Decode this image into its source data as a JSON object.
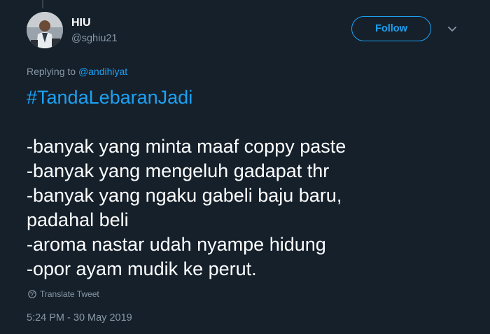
{
  "author": {
    "display_name": "HIU",
    "handle": "@sghiu21"
  },
  "follow_label": "Follow",
  "reply_context": {
    "prefix": "Replying to ",
    "mention": "@andihiyat"
  },
  "tweet": {
    "hashtag": "#TandaLebaranJadi",
    "lines": [
      "-banyak yang minta maaf coppy paste",
      "-banyak yang mengeluh gadapat thr",
      "-banyak yang ngaku gabeli baju baru,",
      "padahal beli",
      "-aroma nastar udah nyampe hidung",
      "-opor ayam mudik ke perut."
    ]
  },
  "translate_label": "Translate Tweet",
  "timestamp": "5:24 PM - 30 May 2019",
  "icons": {
    "avatar": "avatar-photo",
    "more": "chevron-down-icon",
    "translate": "globe-icon"
  },
  "colors": {
    "background": "#15202b",
    "accent": "#1da1f2",
    "secondary_text": "#8899a6",
    "primary_text": "#ffffff"
  }
}
